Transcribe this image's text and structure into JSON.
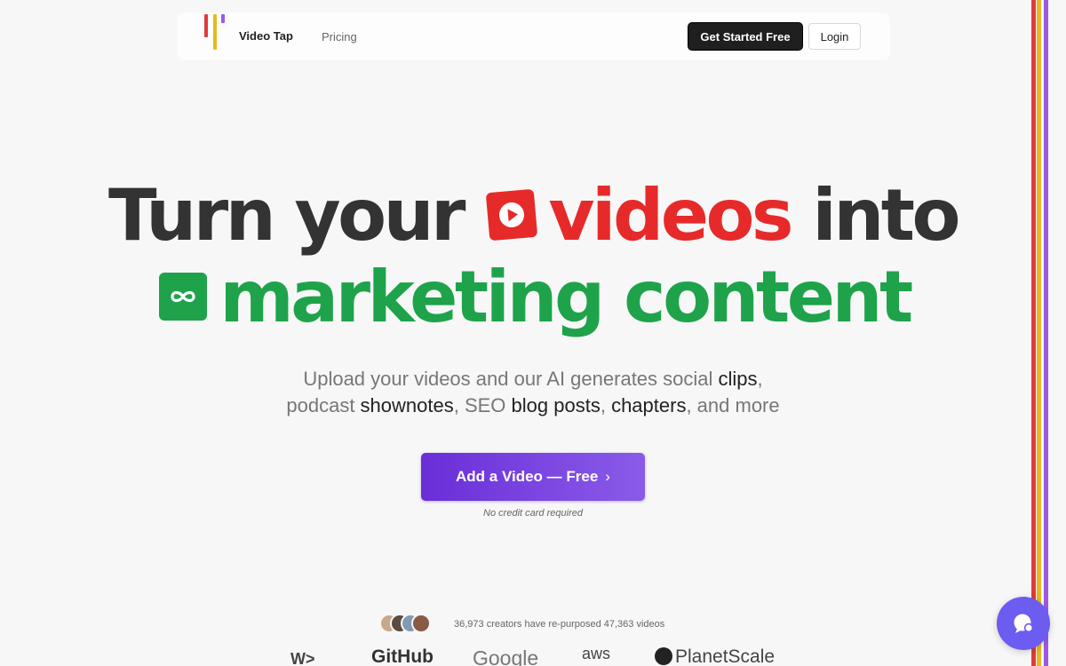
{
  "nav": {
    "brand": "Video Tap",
    "pricing_label": "Pricing",
    "get_started_label": "Get Started Free",
    "login_label": "Login"
  },
  "hero": {
    "line1_text": "Turn your",
    "line1_highlight": "videos",
    "line1_end": "into",
    "line2_text": "marketing content"
  },
  "subheadline": {
    "p1": "Upload your videos and our AI generates social ",
    "h1": "clips",
    "p2": ",",
    "p3": "podcast ",
    "h2": "shownotes",
    "p4": ", SEO ",
    "h3": "blog posts",
    "p5": ", ",
    "h4": "chapters",
    "p6": ", and more"
  },
  "cta": {
    "label": "Add a Video — Free",
    "arrow": "›",
    "note": "No credit card required"
  },
  "social_proof": {
    "text": "36,973 creators have re-purposed 47,363 videos"
  },
  "customer_logos": [
    "W>",
    "GitHub",
    "Google",
    "aws",
    "PlanetScale"
  ],
  "icons": {
    "red_badge": "play-icon",
    "green_badge": "infinity-icon",
    "chat": "chat-icon"
  },
  "colors": {
    "accent_purple": "#6a2ed8",
    "video_red": "#e62a2a",
    "marketing_green": "#1ea34b",
    "stripe_red": "#e03a3a",
    "stripe_yellow": "#e8b820",
    "stripe_purple": "#9b59e8"
  }
}
